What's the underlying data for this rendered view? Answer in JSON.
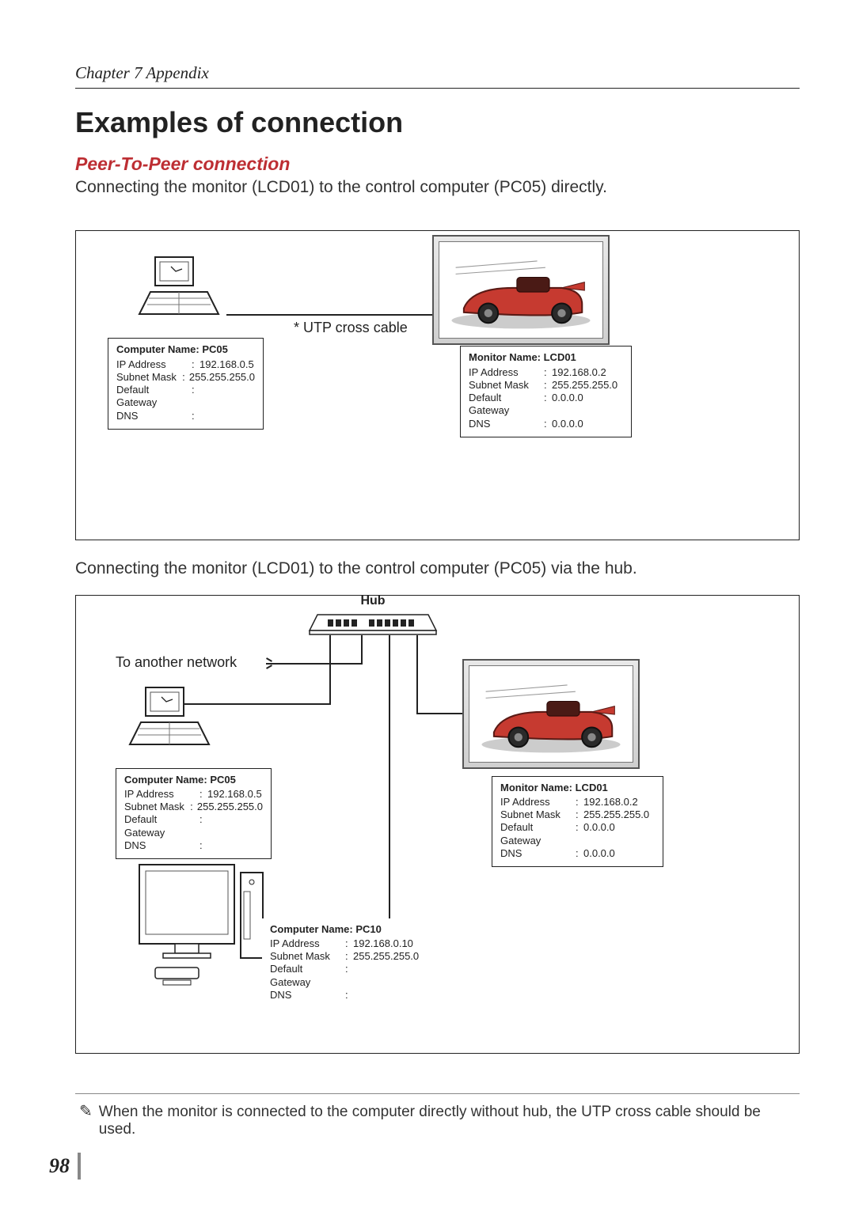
{
  "header": {
    "chapter": "Chapter 7 Appendix"
  },
  "title": "Examples of connection",
  "section": {
    "heading": "Peer-To-Peer connection",
    "desc1": "Connecting the monitor (LCD01) to the control computer (PC05) directly.",
    "desc2": "Connecting the monitor (LCD01) to the control computer (PC05) via the hub."
  },
  "diagram1": {
    "cable_label": "* UTP cross cable",
    "pc": {
      "title": "Computer Name: PC05",
      "ip_label": "IP Address",
      "ip": "192.168.0.5",
      "mask_label": "Subnet Mask",
      "mask": "255.255.255.0",
      "gw_label": "Default Gateway",
      "gw": "",
      "dns_label": "DNS",
      "dns": ""
    },
    "mon": {
      "title": "Monitor Name: LCD01",
      "ip_label": "IP Address",
      "ip": "192.168.0.2",
      "mask_label": "Subnet Mask",
      "mask": "255.255.255.0",
      "gw_label": "Default Gateway",
      "gw": "0.0.0.0",
      "dns_label": "DNS",
      "dns": "0.0.0.0"
    }
  },
  "diagram2": {
    "hub_label": "Hub",
    "network_label": "To another network",
    "pc": {
      "title": "Computer Name: PC05",
      "ip_label": "IP Address",
      "ip": "192.168.0.5",
      "mask_label": "Subnet Mask",
      "mask": "255.255.255.0",
      "gw_label": "Default Gateway",
      "gw": "",
      "dns_label": "DNS",
      "dns": ""
    },
    "mon": {
      "title": "Monitor Name: LCD01",
      "ip_label": "IP Address",
      "ip": "192.168.0.2",
      "mask_label": "Subnet Mask",
      "mask": "255.255.255.0",
      "gw_label": "Default Gateway",
      "gw": "0.0.0.0",
      "dns_label": "DNS",
      "dns": "0.0.0.0"
    },
    "pc2": {
      "title": "Computer Name: PC10",
      "ip_label": "IP Address",
      "ip": "192.168.0.10",
      "mask_label": "Subnet Mask",
      "mask": "255.255.255.0",
      "gw_label": "Default Gateway",
      "gw": "",
      "dns_label": "DNS",
      "dns": ""
    }
  },
  "footnote": {
    "text": "When the monitor is connected to the computer directly without hub, the UTP cross cable should be used."
  },
  "page_number": "98"
}
